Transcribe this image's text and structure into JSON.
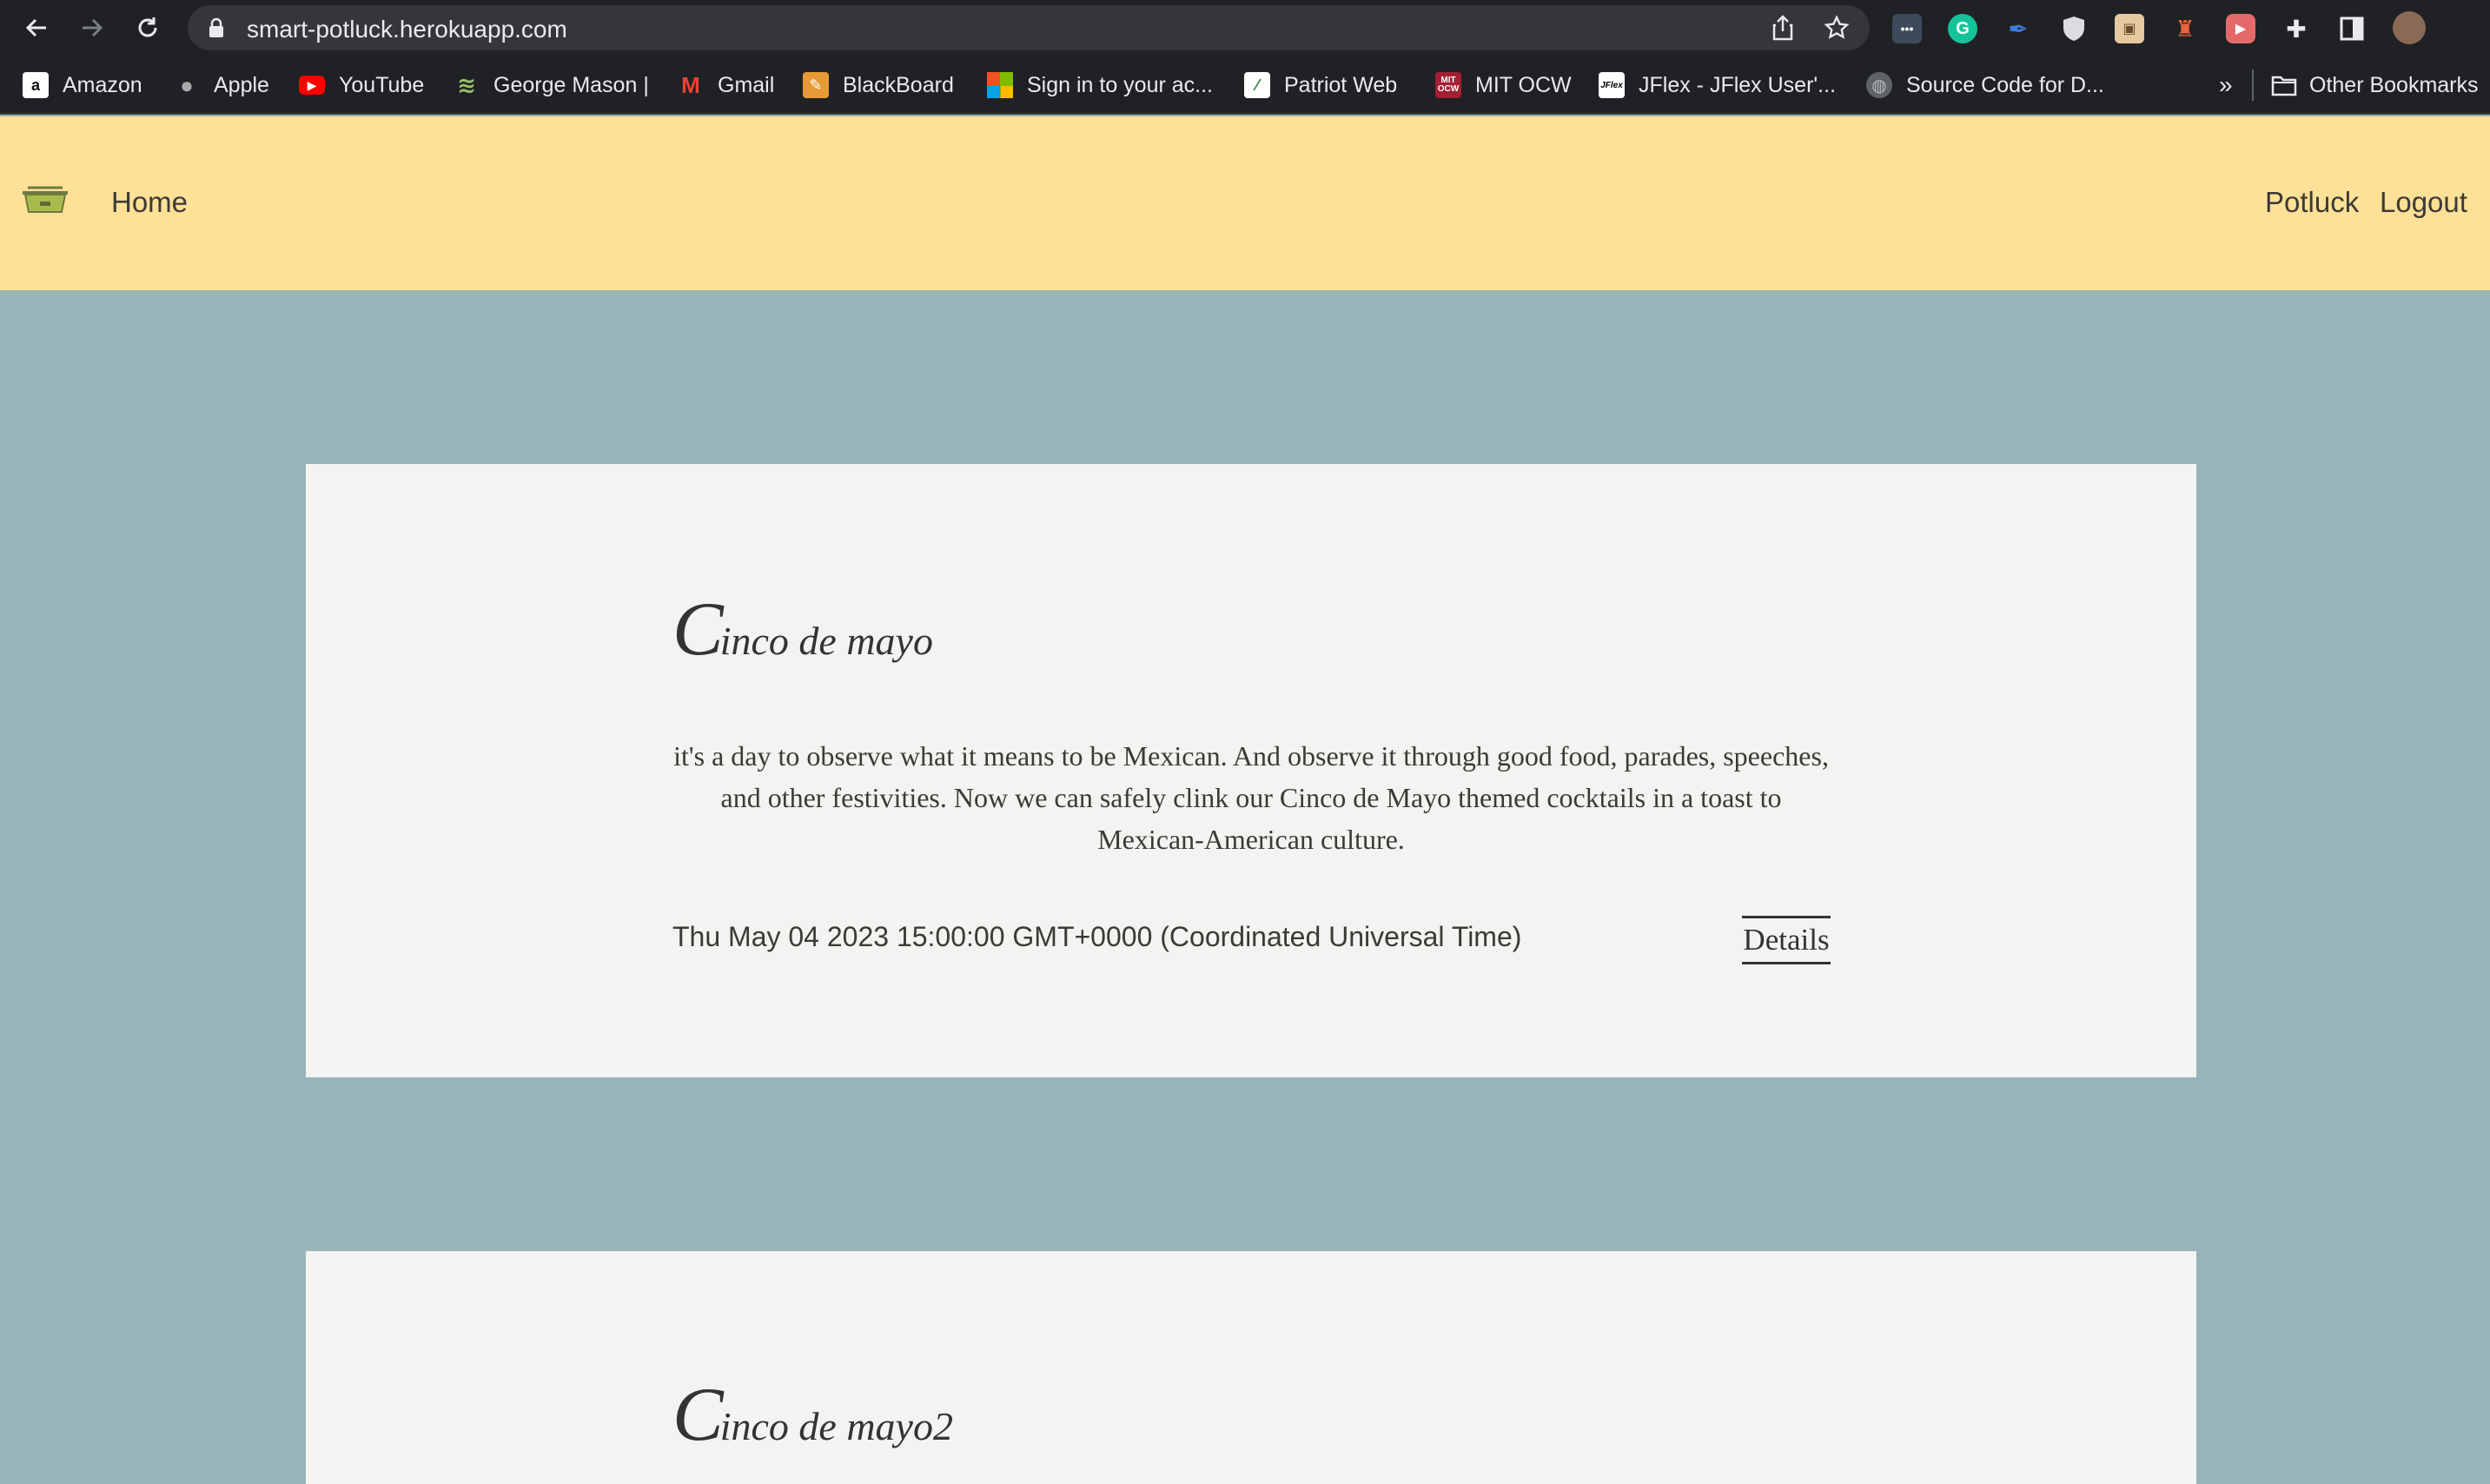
{
  "browser": {
    "url": "smart-potluck.herokuapp.com",
    "nav": {
      "back": "back-arrow-icon",
      "forward": "forward-arrow-icon",
      "reload": "reload-icon"
    },
    "bookmarks": [
      {
        "label": "Amazon",
        "icon": "amazon-icon"
      },
      {
        "label": "Apple",
        "icon": "apple-icon"
      },
      {
        "label": "YouTube",
        "icon": "youtube-icon"
      },
      {
        "label": "George Mason |",
        "icon": "george-mason-icon"
      },
      {
        "label": "Gmail",
        "icon": "gmail-icon"
      },
      {
        "label": "BlackBoard",
        "icon": "blackboard-icon"
      },
      {
        "label": "Sign in to your ac...",
        "icon": "microsoft-icon"
      },
      {
        "label": "Patriot Web",
        "icon": "patriot-web-icon"
      },
      {
        "label": "MIT OCW",
        "icon": "mit-ocw-icon"
      },
      {
        "label": "JFlex - JFlex User'...",
        "icon": "jflex-icon"
      },
      {
        "label": "Source Code for D...",
        "icon": "globe-icon"
      }
    ],
    "overflow": "»",
    "other_bookmarks": "Other Bookmarks"
  },
  "site": {
    "nav_home": "Home",
    "nav_potluck": "Potluck",
    "nav_logout": "Logout",
    "colors": {
      "header": "#fde197",
      "background": "#98b4b9",
      "card": "#f3f3f1"
    }
  },
  "events": [
    {
      "title_initial": "C",
      "title_rest": "inco de mayo",
      "description": "it's a day to observe what it means to be Mexican. And observe it through good food, parades, speeches, and other festivities. Now we can safely clink our Cinco de Mayo themed cocktails in a toast to Mexican-American culture.",
      "date": "Thu May 04 2023 15:00:00 GMT+0000 (Coordinated Universal Time)",
      "details_label": "Details"
    },
    {
      "title_initial": "C",
      "title_rest": "inco de mayo2"
    }
  ]
}
